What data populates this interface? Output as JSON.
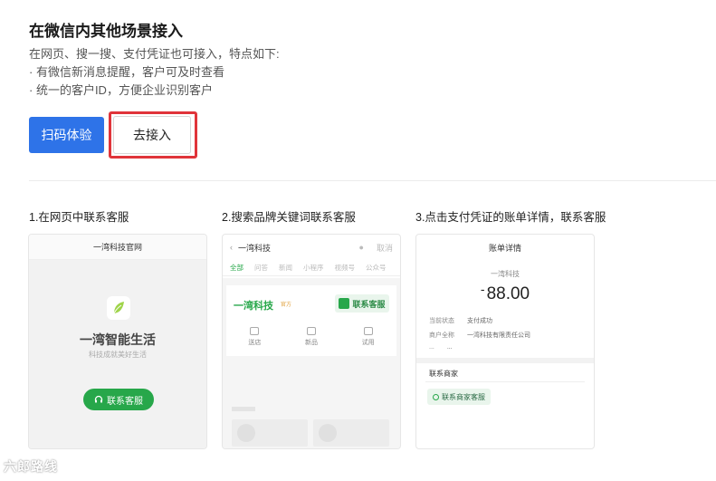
{
  "section": {
    "title": "在微信内其他场景接入",
    "description_lines": [
      "在网页、搜一搜、支付凭证也可接入，特点如下:",
      "· 有微信新消息提醒，客户可及时查看",
      "· 统一的客户ID，方便企业识别客户"
    ]
  },
  "actions": {
    "scan_label": "扫码体验",
    "connect_label": "去接入"
  },
  "steps": [
    {
      "title": "1.在网页中联系客服",
      "header": "一湾科技官网",
      "brand": "一湾智能生活",
      "slogan": "科技成就美好生活",
      "button": "联系客服"
    },
    {
      "title": "2.搜索品牌关键词联系客服",
      "query": "一湾科技",
      "cancel": "取消",
      "tabs": [
        "全部",
        "问答",
        "新闻",
        "小程序",
        "视频号",
        "公众号"
      ],
      "result_name": "一湾科技",
      "result_tag": "官方",
      "button": "联系客服",
      "quick_links": [
        "送店",
        "新品",
        "试用"
      ]
    },
    {
      "title": "3.点击支付凭证的账单详情，联系客服",
      "header": "账单详情",
      "merchant": "一湾科技",
      "amount_sign": "-",
      "amount": "88.00",
      "rows": [
        {
          "label": "当前状态",
          "value": "支付成功"
        },
        {
          "label": "商户全称",
          "value": "一湾科技有限责任公司"
        },
        {
          "label": "...",
          "value": "..."
        }
      ],
      "section_label": "联系商家",
      "button": "联系商家客服"
    }
  ],
  "watermark": "六郎路线",
  "colors": {
    "primary": "#2e73e8",
    "highlight": "#e0343a",
    "wechat_green": "#27a74a"
  }
}
